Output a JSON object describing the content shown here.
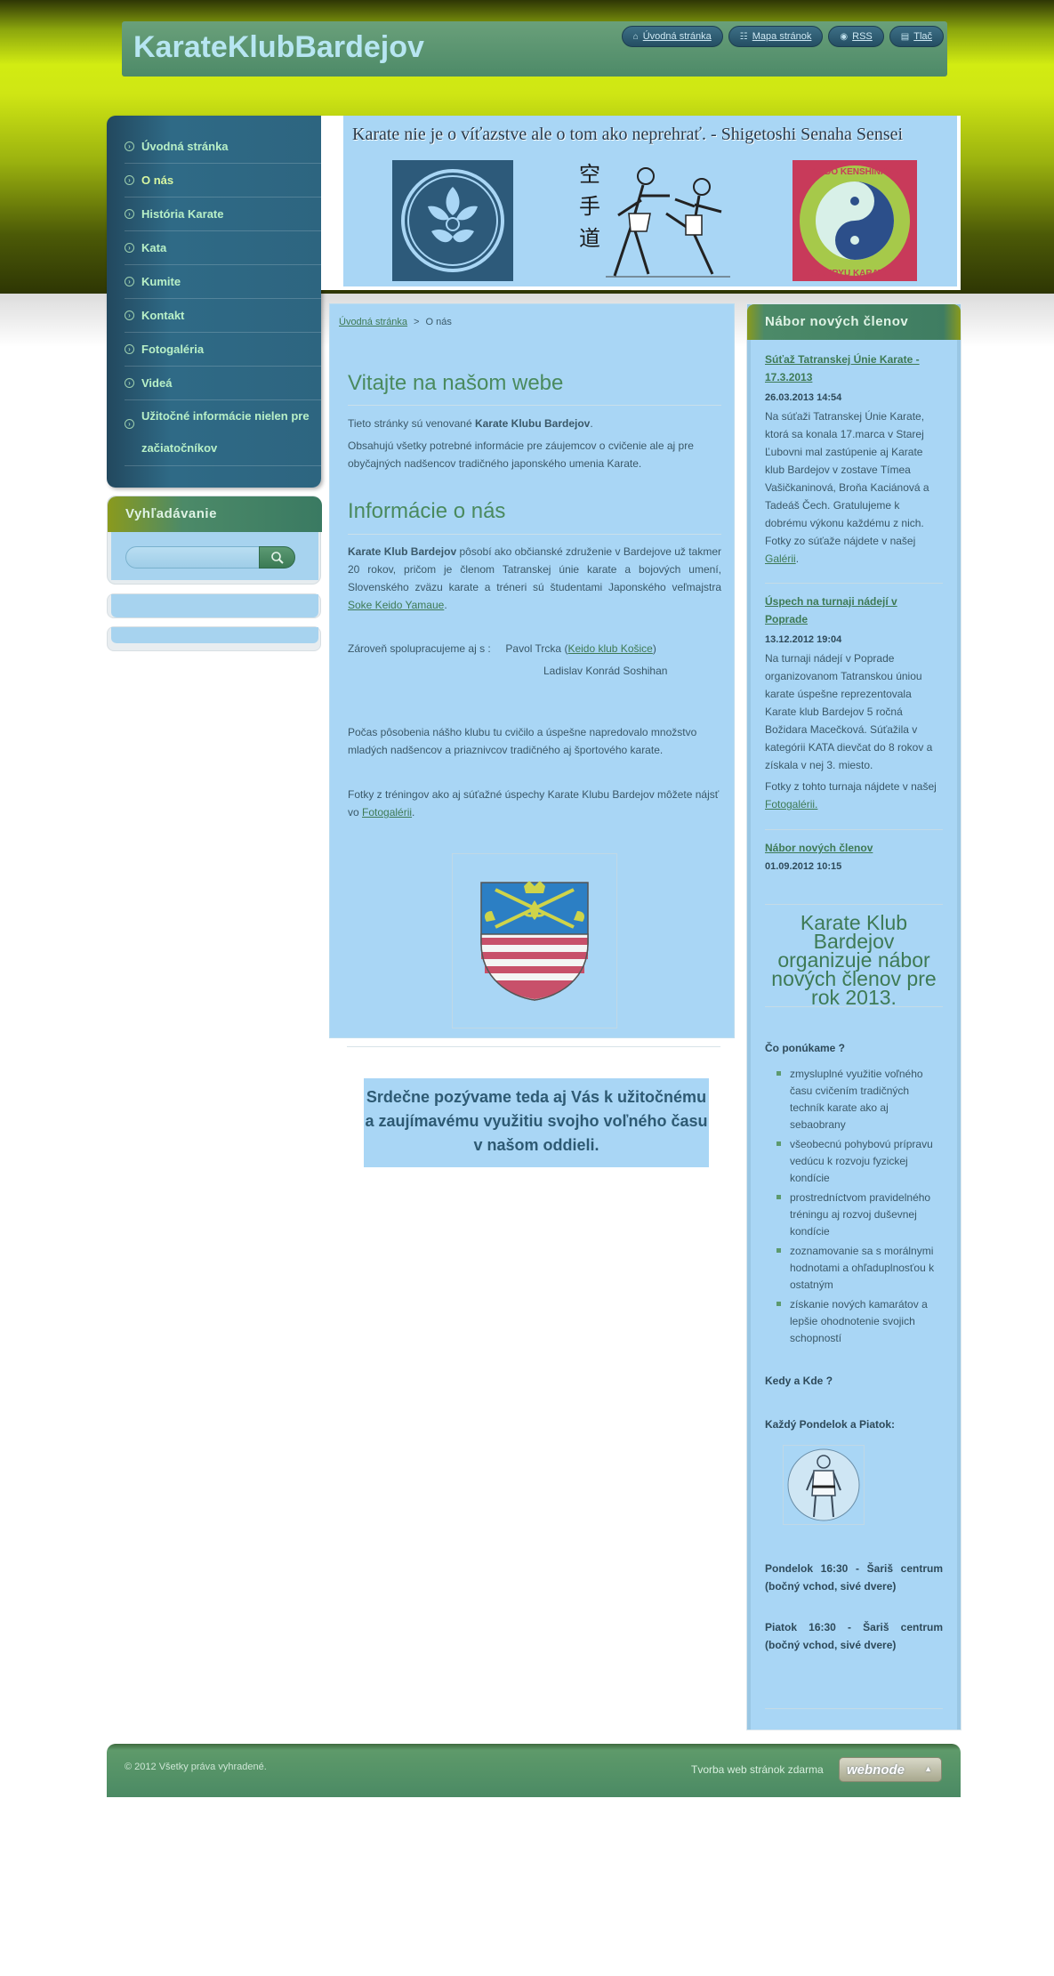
{
  "site": {
    "title": "KarateKlubBardejov"
  },
  "top_links": [
    {
      "label": "Úvodná stránka",
      "icon": "home-icon"
    },
    {
      "label": "Mapa stránok",
      "icon": "sitemap-icon"
    },
    {
      "label": "RSS",
      "icon": "rss-icon"
    },
    {
      "label": "Tlač",
      "icon": "print-icon"
    }
  ],
  "menu": [
    {
      "label": "Úvodná stránka"
    },
    {
      "label": "O nás"
    },
    {
      "label": "História Karate"
    },
    {
      "label": "Kata"
    },
    {
      "label": "Kumite"
    },
    {
      "label": "Kontakt"
    },
    {
      "label": "Fotogaléria"
    },
    {
      "label": "Videá"
    },
    {
      "label": "Užitočné informácie nielen pre začiatočníkov"
    }
  ],
  "active_menu": "O nás",
  "search": {
    "title": "Vyhľadávanie",
    "value": ""
  },
  "banner": {
    "quote": "Karate nie je o víťazstve ale o tom ako neprehrať. - Shigetoshi Senaha Sensei",
    "kanji": "空 手 道",
    "badge_text": "KEIDO KENSHINKAN GOJURYU KARATEDO"
  },
  "breadcrumb": {
    "home": "Úvodná stránka",
    "separator": ">",
    "current": "O nás"
  },
  "main": {
    "welcome_title": "Vitajte na našom webe",
    "welcome_p1_pre": "Tieto stránky sú venované ",
    "welcome_p1_bold": "Karate Klubu Bardejov",
    "welcome_p1_post": ".",
    "welcome_p2": "Obsahujú všetky potrebné informácie pre záujemcov o cvičenie ale aj pre obyčajných nadšencov tradičného japonského umenia Karate.",
    "about_title": "Informácie o nás",
    "about_p1_bold": "Karate Klub Bardejov",
    "about_p1_text": " pôsobí ako občianské združenie v Bardejove už takmer 20 rokov, pričom je členom Tatranskej únie karate a bojových umení, Slovenského zväzu karate a tréneri sú študentami Japonského veľmajstra ",
    "about_p1_link": "Soke Keido Yamaue",
    "about_p1_end": ".",
    "coop_text": "Zároveň spolupracujeme aj s :     Pavol Trcka (",
    "coop_link": "Keido klub Košice",
    "coop_end": ")",
    "coop_line2": "Ladislav Konrád Soshihan",
    "p_progress": "Počas pôsobenia nášho klubu tu cvičilo a úspešne napredovalo množstvo mladých nadšencov a priaznivcov tradičného aj športového karate.",
    "p_photos_pre": "Fotky z tréningov ako aj súťažné úspechy Karate Klubu Bardejov môžete nájsť vo ",
    "p_photos_link": "Fotogalérii",
    "p_photos_post": ".",
    "invite": "Srdečne pozývame teda aj Vás k užitočnému a zaujímavému využitiu svojho voľného času v našom oddieli."
  },
  "news": {
    "title": "Nábor nových členov",
    "items": [
      {
        "title": "Súťaž Tatranskej Únie Karate - 17.3.2013",
        "date": "26.03.2013 14:54",
        "text": "Na súťaži Tatranskej Únie Karate, ktorá sa konala 17.marca v Starej Ľubovni mal zastúpenie aj Karate klub Bardejov v zostave Tímea Vašičkaninová, Broňa Kaciánová a Tadeáš Čech. Gratulujeme k dobrému výkonu každému z nich. Fotky zo súťaže nájdete v našej ",
        "link": "Galérii",
        "end": "."
      },
      {
        "title": "Úspech na turnaji nádejí v Poprade",
        "date": "13.12.2012 19:04",
        "text": "Na turnaji nádejí v Poprade organizovanom Tatranskou úniou karate úspešne reprezentovala Karate klub Bardejov 5 ročná Božidara Macečková. Súťažila v kategórii KATA dievčat do 8 rokov a získala v nej 3. miesto.",
        "text2": "Fotky z tohto turnaja nájdete v našej ",
        "link": "Fotogalérii."
      },
      {
        "title": "Nábor nových členov",
        "date": "01.09.2012 10:15"
      }
    ],
    "big_text": "Karate Klub Bardejov organizuje nábor nových členov pre rok 2013.",
    "offer_title": "Čo ponúkame ?",
    "offer_items": [
      "zmysluplné využitie voľného času cvičením tradičných techník karate ako aj sebaobrany",
      "všeobecnú pohybovú prípravu vedúcu k rozvoju fyzickej kondície",
      "prostredníctvom pravidelného tréningu aj rozvoj duševnej kondície",
      "zoznamovanie sa s morálnymi hodnotami a ohľaduplnosťou k ostatným",
      "získanie nových kamarátov a lepšie ohodnotenie svojich schopností"
    ],
    "when_title": "Kedy a Kde ?",
    "when_days": "Každý Pondelok a Piatok:",
    "schedule": [
      "Pondelok 16:30 - Šariš centrum (bočný vchod, sivé dvere)",
      "Piatok 16:30 - Šariš centrum (bočný vchod, sivé dvere)"
    ]
  },
  "footer": {
    "copyright": "© 2012 Všetky práva vyhradené.",
    "made_by": "Tvorba web stránok zdarma",
    "webnode_label": "webnode",
    "webnode_arrow": "▲"
  }
}
